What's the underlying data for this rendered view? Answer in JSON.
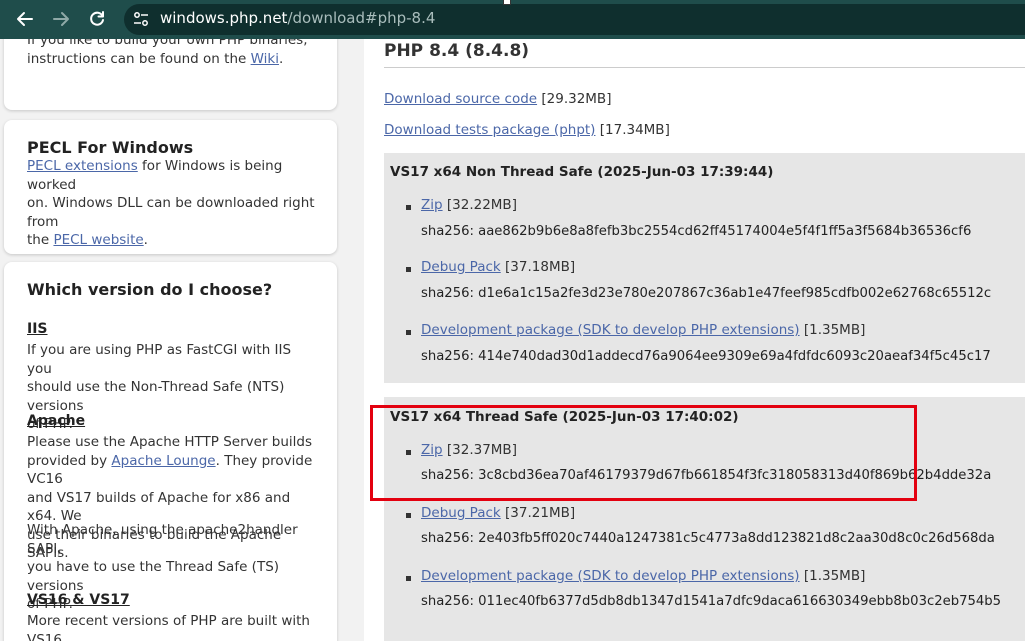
{
  "browser": {
    "url_host": "windows.php.net",
    "url_path": "/download#php-8.4",
    "icons": [
      "back-arrow-icon",
      "forward-arrow-icon",
      "reload-icon",
      "site-settings-icon"
    ]
  },
  "sidebar": {
    "card1": {
      "line1": "If you like to build your own PHP binaries,",
      "line2_pre": "instructions can be found on the ",
      "line2_link": "Wiki",
      "line2_post": "."
    },
    "pecl": {
      "title": "PECL For Windows",
      "l1_link": "PECL extensions",
      "l1_post": " for Windows is being worked",
      "l2": "on. Windows DLL can be downloaded right from",
      "l3_pre": "the ",
      "l3_link": "PECL website",
      "l3_post": "."
    },
    "choose": {
      "title": "Which version do I choose?",
      "iis_title": "IIS",
      "iis_l1": "If you are using PHP as FastCGI with IIS you",
      "iis_l2": "should use the Non-Thread Safe (NTS) versions",
      "iis_l3": "of PHP.",
      "apache_title": "Apache",
      "ap_l1": "Please use the Apache HTTP Server builds",
      "ap_l2_pre": "provided by ",
      "ap_l2_link": "Apache Lounge",
      "ap_l2_post": ". They provide VC16",
      "ap_l3": "and VS17 builds of Apache for x86 and x64. We",
      "ap_l4": "use their binaries to build the Apache SAPIs.",
      "ap2_l1": "With Apache, using the apache2handler SAPI,",
      "ap2_l2": "you have to use the Thread Safe (TS) versions",
      "ap2_l3": "of PHP.",
      "vs_title": "VS16 & VS17",
      "vs_l1": "More recent versions of PHP are built with VS16"
    }
  },
  "main": {
    "heading": "PHP 8.4 (8.4.8)",
    "source": {
      "label": "Download source code",
      "size": "[29.32MB]"
    },
    "tests": {
      "label": "Download tests package (phpt)",
      "size": "[17.34MB]"
    },
    "nts": {
      "title": "VS17 x64 Non Thread Safe (2025-Jun-03 17:39:44)",
      "zip": {
        "label": "Zip",
        "size": "[32.22MB]",
        "sha": "sha256: aae862b9b6e8a8fefb3bc2554cd62ff45174004e5f4f1ff5a3f5684b36536cf6"
      },
      "debug": {
        "label": "Debug Pack",
        "size": "[37.18MB]",
        "sha": "sha256: d1e6a1c15a2fe3d23e780e207867c36ab1e47feef985cdfb002e62768c65512c"
      },
      "dev": {
        "label": "Development package (SDK to develop PHP extensions)",
        "size": "[1.35MB]",
        "sha": "sha256: 414e740dad30d1addecd76a9064ee9309e69a4fdfdc6093c20aeaf34f5c45c17"
      }
    },
    "ts": {
      "title": "VS17 x64 Thread Safe (2025-Jun-03 17:40:02)",
      "zip": {
        "label": "Zip",
        "size": "[32.37MB]",
        "sha": "sha256: 3c8cbd36ea70af46179379d67fb661854f3fc318058313d40f869b62b4dde32a"
      },
      "debug": {
        "label": "Debug Pack",
        "size": "[37.21MB]",
        "sha": "sha256: 2e403fb5ff020c7440a1247381c5c4773a8dd123821d8c2aa30d8c0c26d568da"
      },
      "dev": {
        "label": "Development package (SDK to develop PHP extensions)",
        "size": "[1.35MB]",
        "sha": "sha256: 011ec40fb6377d5db8db1347d1541a7dfc9daca616630349ebb8b03c2eb754b5"
      }
    }
  },
  "colors": {
    "highlight": "#e3000f",
    "toolbar": "#1f4d4b",
    "link": "#4b67a8"
  }
}
